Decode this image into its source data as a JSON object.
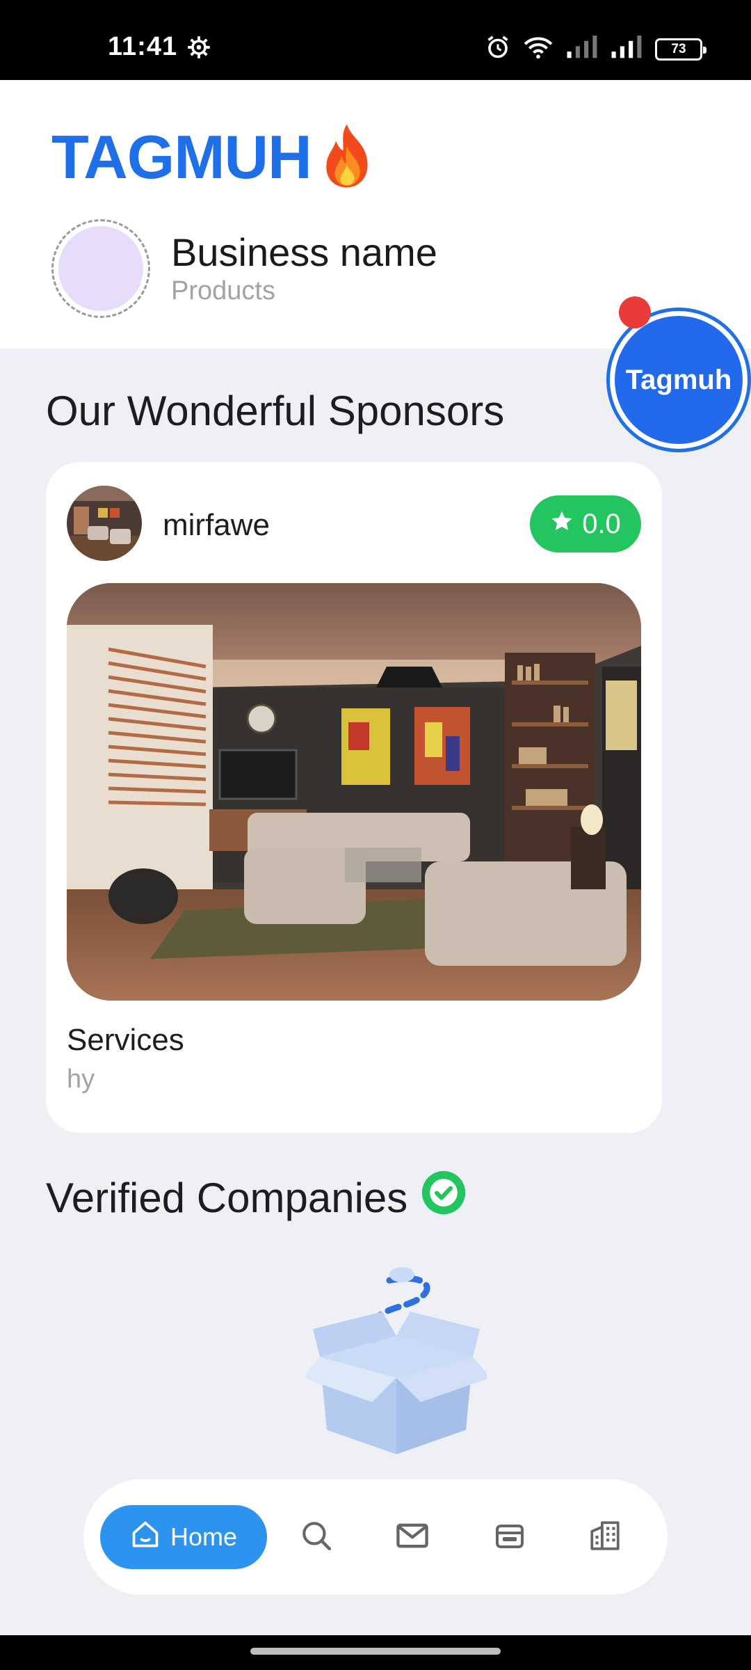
{
  "status_bar": {
    "time": "11:41",
    "battery": "73",
    "icons": [
      "settings-gear-icon",
      "alarm-icon",
      "wifi-icon",
      "signal-icon",
      "signal-icon",
      "battery-icon"
    ]
  },
  "header": {
    "brand": "TAGMUH",
    "brand_icon": "fire-icon",
    "business_name": "Business name",
    "business_subtitle": "Products"
  },
  "fab": {
    "label": "Tagmuh",
    "badge_color": "#ea3b3b"
  },
  "sponsors": {
    "title": "Our Wonderful Sponsors",
    "cards": [
      {
        "name": "mirfawe",
        "rating": "0.0",
        "title": "Services",
        "subtitle": "hy"
      }
    ]
  },
  "verified": {
    "title": "Verified Companies",
    "icon": "verified-check-icon",
    "empty_icon": "empty-box-icon"
  },
  "bottom_nav": {
    "items": [
      {
        "label": "Home",
        "icon": "home-icon",
        "active": true
      },
      {
        "label": "",
        "icon": "search-icon",
        "active": false
      },
      {
        "label": "",
        "icon": "mail-icon",
        "active": false
      },
      {
        "label": "",
        "icon": "ticket-icon",
        "active": false
      },
      {
        "label": "",
        "icon": "buildings-icon",
        "active": false
      }
    ]
  },
  "colors": {
    "brand_blue": "#1f6fe8",
    "rating_green": "#22c55e",
    "nav_active": "#2c94ee",
    "background": "#eef0f6"
  }
}
